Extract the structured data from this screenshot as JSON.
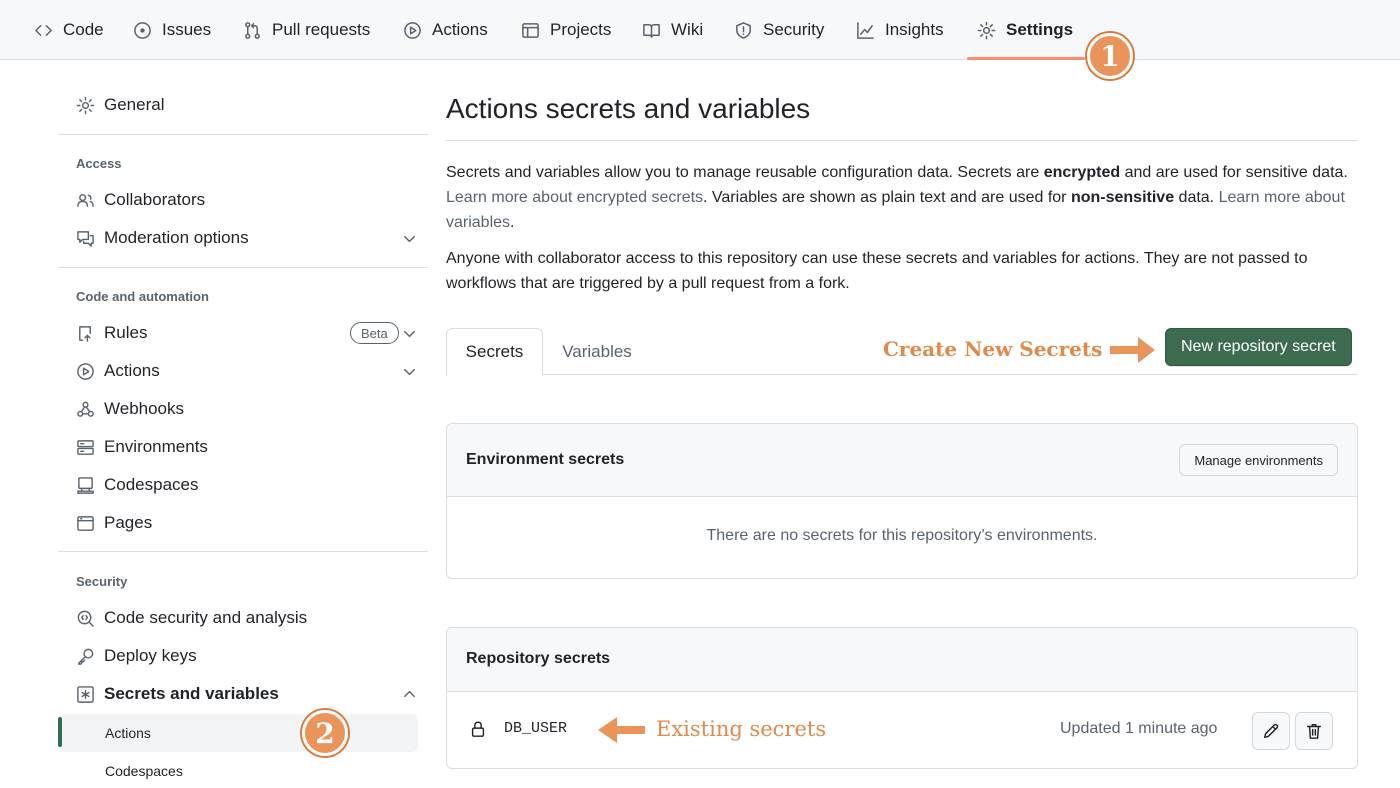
{
  "topnav": {
    "tabs": [
      {
        "label": "Code",
        "icon": "code-icon"
      },
      {
        "label": "Issues",
        "icon": "issue-icon"
      },
      {
        "label": "Pull requests",
        "icon": "pull-request-icon"
      },
      {
        "label": "Actions",
        "icon": "play-icon"
      },
      {
        "label": "Projects",
        "icon": "table-icon"
      },
      {
        "label": "Wiki",
        "icon": "book-icon"
      },
      {
        "label": "Security",
        "icon": "shield-icon"
      },
      {
        "label": "Insights",
        "icon": "graph-icon"
      },
      {
        "label": "Settings",
        "icon": "gear-icon",
        "active": true
      }
    ]
  },
  "annotations": {
    "step1": "1",
    "step2": "2",
    "create_new": "Create New Secrets",
    "existing": "Existing secrets",
    "accent_color": "#e08a4d"
  },
  "sidebar": {
    "general": "General",
    "access_heading": "Access",
    "access_items": [
      "Collaborators",
      "Moderation options"
    ],
    "code_heading": "Code and automation",
    "code_items": [
      "Rules",
      "Actions",
      "Webhooks",
      "Environments",
      "Codespaces",
      "Pages"
    ],
    "beta": "Beta",
    "security_heading": "Security",
    "security_items": [
      "Code security and analysis",
      "Deploy keys",
      "Secrets and variables"
    ],
    "sub_items": [
      "Actions",
      "Codespaces"
    ]
  },
  "main": {
    "title": "Actions secrets and variables",
    "p1_a": "Secrets and variables allow you to manage reusable configuration data. Secrets are ",
    "p1_b": "encrypted",
    "p1_c": " and are used for sensitive data. ",
    "p1_link1": "Learn more about encrypted secrets",
    "p1_d": ". Variables are shown as plain text and are used for ",
    "p1_e": "non-sensitive",
    "p1_f": " data. ",
    "p1_link2": "Learn more about variables",
    "p1_g": ".",
    "p2": "Anyone with collaborator access to this repository can use these secrets and variables for actions. They are not passed to workflows that are triggered by a pull request from a fork.",
    "tabs": [
      "Secrets",
      "Variables"
    ],
    "new_secret_button": "New repository secret",
    "env_box": {
      "title": "Environment secrets",
      "button": "Manage environments",
      "empty": "There are no secrets for this repository’s environments."
    },
    "repo_box": {
      "title": "Repository secrets",
      "secrets": [
        {
          "name": "DB_USER",
          "updated": "Updated 1 minute ago"
        }
      ]
    },
    "primary_color": "#3d6b4f"
  }
}
